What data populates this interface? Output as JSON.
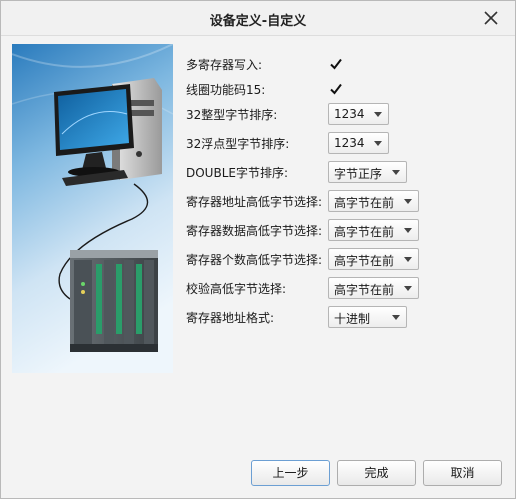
{
  "window": {
    "title": "设备定义-自定义"
  },
  "form": {
    "rows": [
      {
        "label": "多寄存器写入:",
        "type": "checkbox",
        "checked": true
      },
      {
        "label": "线圈功能码15:",
        "type": "checkbox",
        "checked": true
      },
      {
        "label": "32整型字节排序:",
        "type": "select",
        "value": "1234"
      },
      {
        "label": "32浮点型字节排序:",
        "type": "select",
        "value": "1234"
      },
      {
        "label": "DOUBLE字节排序:",
        "type": "select",
        "value": "字节正序"
      },
      {
        "label": "寄存器地址高低字节选择:",
        "type": "select",
        "value": "高字节在前"
      },
      {
        "label": "寄存器数据高低字节选择:",
        "type": "select",
        "value": "高字节在前"
      },
      {
        "label": "寄存器个数高低字节选择:",
        "type": "select",
        "value": "高字节在前"
      },
      {
        "label": "校验高低字节选择:",
        "type": "select",
        "value": "高字节在前"
      },
      {
        "label": "寄存器地址格式:",
        "type": "select",
        "value": "十进制"
      }
    ]
  },
  "buttons": {
    "prev": "上一步",
    "finish": "完成",
    "cancel": "取消"
  },
  "colors": {
    "illustration_top": "#2b7fc2",
    "illustration_bottom": "#e9f3fb",
    "primary_border": "#6c9fd3"
  }
}
